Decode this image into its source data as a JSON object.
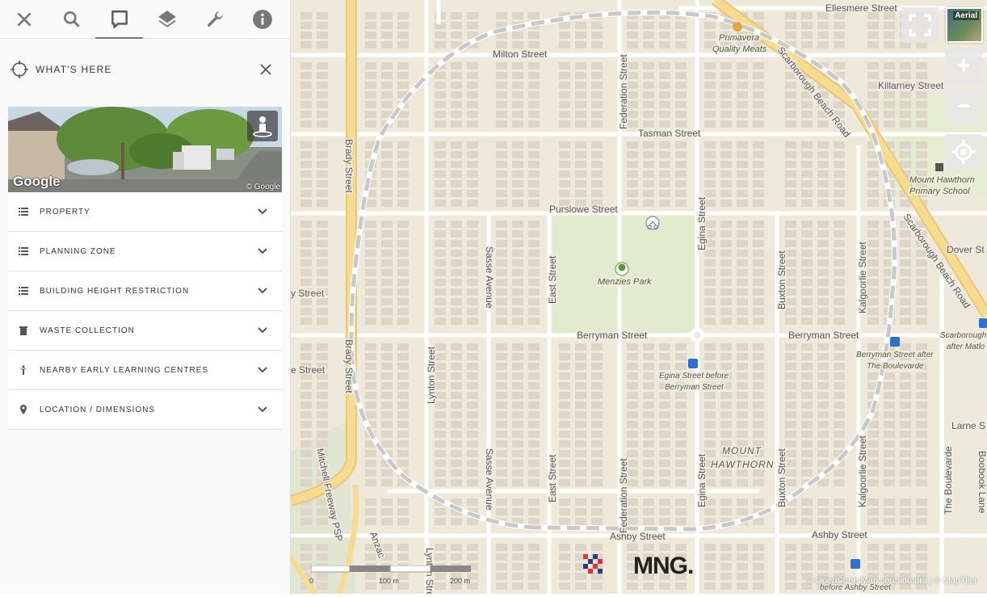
{
  "toolbar": {
    "icons": [
      "close-icon",
      "search-icon",
      "comment-icon",
      "layers-icon",
      "wrench-icon",
      "info-icon"
    ],
    "active": "comment-icon"
  },
  "panel": {
    "title": "WHAT'S HERE",
    "streetview": {
      "logo": "Google",
      "copyright": "© Google"
    },
    "sections": [
      {
        "label": "PROPERTY",
        "icon": "list-icon"
      },
      {
        "label": "PLANNING ZONE",
        "icon": "list-icon"
      },
      {
        "label": "BUILDING HEIGHT RESTRICTION",
        "icon": "list-icon"
      },
      {
        "label": "WASTE COLLECTION",
        "icon": "trash-icon"
      },
      {
        "label": "NEARBY EARLY LEARNING CENTRES",
        "icon": "child-icon"
      },
      {
        "label": "LOCATION / DIMENSIONS",
        "icon": "pin-icon"
      }
    ]
  },
  "map": {
    "controls": {
      "aerial_label": "Aerial",
      "zoom_in": "+",
      "zoom_out": "−"
    },
    "streets": {
      "ellesmere": "Ellesmere Street",
      "milton": "Milton Street",
      "killarney": "Killarney Street",
      "tasman": "Tasman Street",
      "purslowe": "Purslowe Street",
      "dover": "Dover St",
      "berryman1": "Berryman Street",
      "berryman2": "Berryman Street",
      "ashby1": "Ashby Street",
      "ashby2": "Ashby Street",
      "larne": "Larne S",
      "brady1": "Brady Street",
      "brady2": "Brady Street",
      "federation1": "Federation Street",
      "federation2": "Federation Street",
      "egina1": "Egina Street",
      "egina2": "Egina Street",
      "buxton1": "Buxton Street",
      "buxton2": "Buxton Street",
      "kalgoorlie1": "Kalgoorlie Street",
      "kalgoorlie2": "Kalgoorlie Street",
      "sasse1": "Sasse Avenue",
      "sasse2": "Sasse Avenue",
      "east1": "East Street",
      "east2": "East Street",
      "lynton1": "Lynton Street",
      "lynton2": "Lynton Street",
      "scarborough1": "Scarborough Beach Road",
      "scarborough2": "Scarborough Beach Road",
      "boulevarde": "The Boulevarde",
      "boobook": "Boobook Lane",
      "mitchell": "Mitchell Freeway PSP",
      "anzac": "Anzac",
      "left1": "y Street",
      "left2": "e Street"
    },
    "pois": {
      "primavera1": "Primavera",
      "primavera2": "Quality Meats",
      "menzies": "Menzies Park",
      "school1": "Mount Hawthorn",
      "school2": "Primary School",
      "suburb1": "MOUNT",
      "suburb2": "HAWTHORN",
      "bus1a": "Egina Street before",
      "bus1b": "Berryman Street",
      "bus2a": "Berryman Street after",
      "bus2b": "The Boulevarde",
      "bus3a": "Scarborough",
      "bus3b": "after Matlo",
      "bus4": "before Ashby Street"
    },
    "scale": {
      "zero": "0",
      "mid": "100 m",
      "max": "200 m"
    },
    "attribution": "© OpenStreetMap contributors | © MapTiler",
    "brand": "MNG."
  }
}
